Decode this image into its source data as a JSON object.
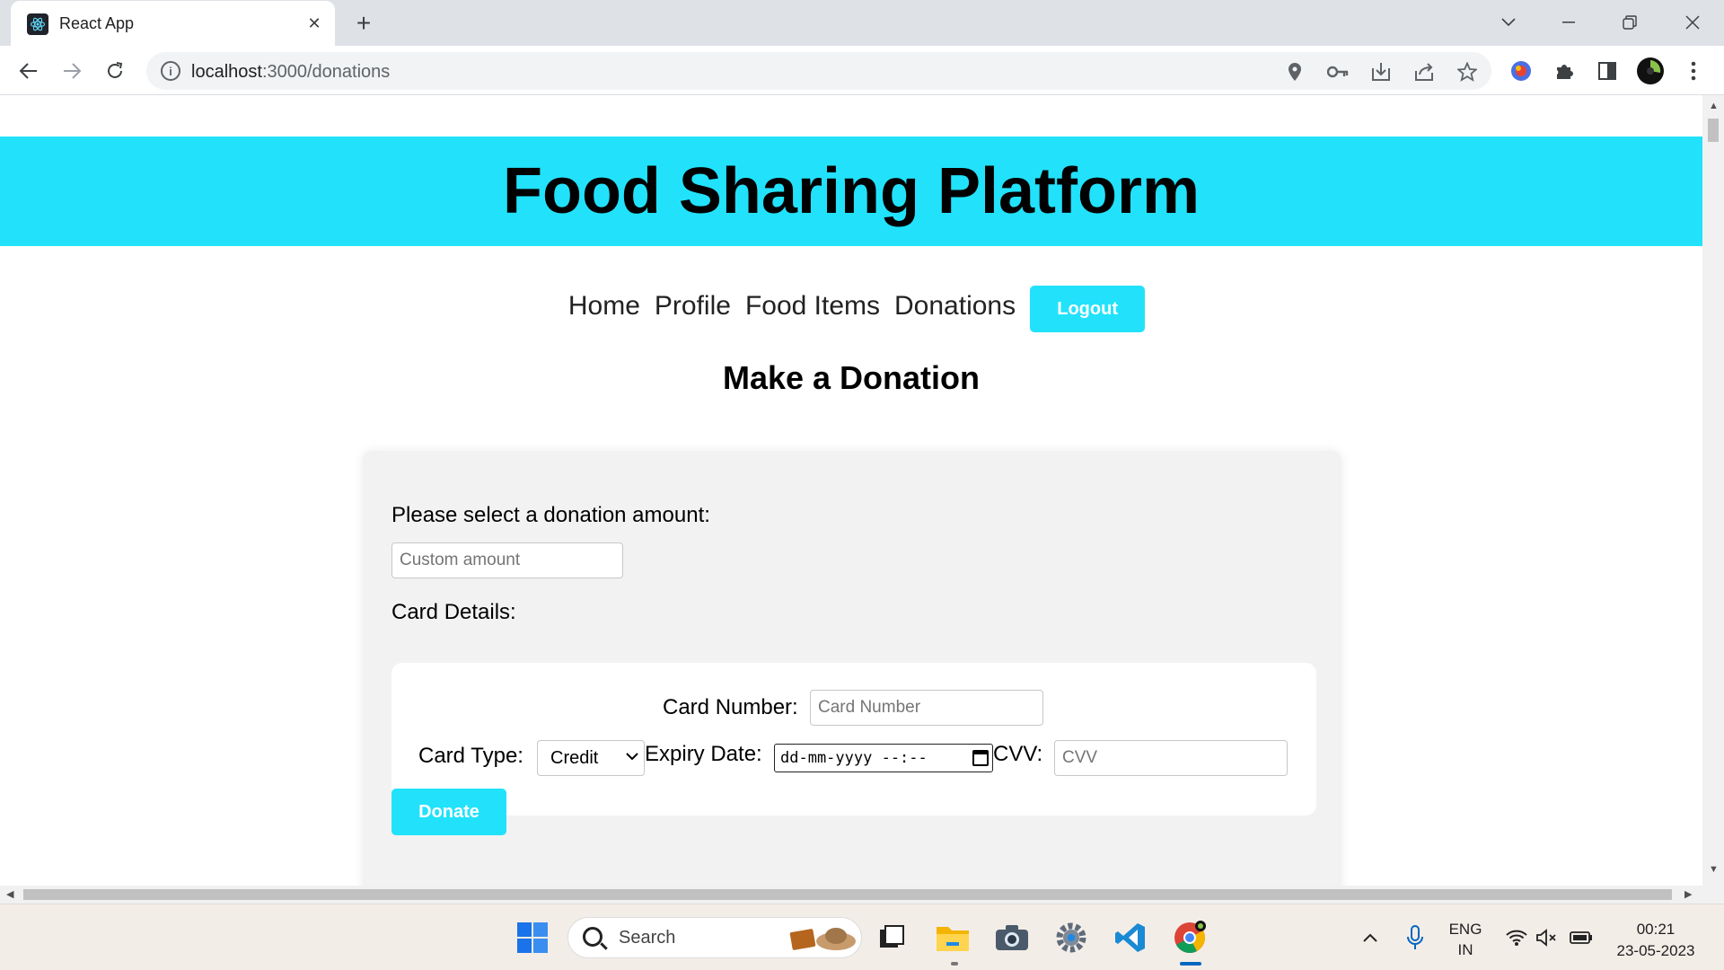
{
  "browser": {
    "tab_title": "React App",
    "url_host": "localhost",
    "url_path": ":3000/donations"
  },
  "page": {
    "site_title": "Food Sharing Platform",
    "nav": [
      "Home",
      "Profile",
      "Food Items",
      "Donations"
    ],
    "logout_label": "Logout",
    "heading": "Make a Donation",
    "amount_label": "Please select a donation amount:",
    "amount_placeholder": "Custom amount",
    "card_details_label": "Card Details:",
    "card_number_label": "Card Number:",
    "card_number_placeholder": "Card Number",
    "card_type_label": "Card Type:",
    "card_type_value": "Credit",
    "expiry_label": "Expiry Date:",
    "expiry_placeholder": "dd-mm-yyyy --:--",
    "cvv_label": "CVV:",
    "cvv_placeholder": "CVV",
    "donate_label": "Donate"
  },
  "taskbar": {
    "search_label": "Search",
    "lang_line1": "ENG",
    "lang_line2": "IN",
    "time": "00:21",
    "date": "23-05-2023"
  },
  "colors": {
    "accent": "#22e2fb",
    "page_bg": "#ffffff",
    "card_bg": "#f2f2f2"
  }
}
